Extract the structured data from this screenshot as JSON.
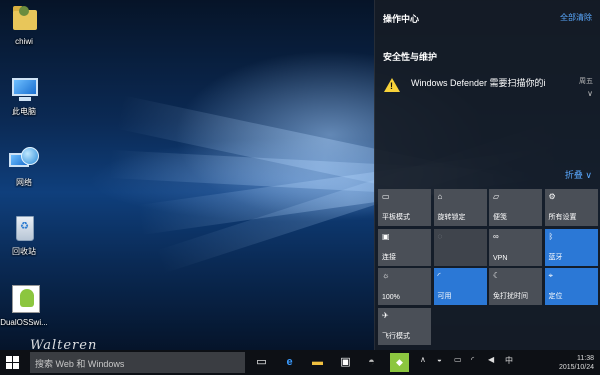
{
  "desktop": {
    "icons": [
      {
        "label": "chiwi"
      },
      {
        "label": "此电脑"
      },
      {
        "label": "网络"
      },
      {
        "label": "回收站"
      },
      {
        "label": "DualOSSwi..."
      }
    ],
    "watermark": "Walteren"
  },
  "action_center": {
    "title": "操作中心",
    "clear_all": "全部清除",
    "group_title": "安全性与维护",
    "notification": {
      "text": "Windows Defender 需要扫描你的i",
      "day": "周五",
      "expand_icon": "chevron-down-icon",
      "icon": "warning-icon"
    },
    "collapse_label": "折叠",
    "tiles": [
      {
        "label": "平板模式",
        "icon": "tablet-icon",
        "state": "off",
        "glyph": "▭"
      },
      {
        "label": "旋转锁定",
        "icon": "rotation-lock-icon",
        "state": "off",
        "glyph": "⌂"
      },
      {
        "label": "便笺",
        "icon": "note-icon",
        "state": "off",
        "glyph": "▱"
      },
      {
        "label": "所有设置",
        "icon": "gear-icon",
        "state": "off",
        "glyph": "⚙"
      },
      {
        "label": "连接",
        "icon": "connect-icon",
        "state": "off",
        "glyph": "▣"
      },
      {
        "label": "",
        "icon": "location-icon",
        "state": "disabled",
        "glyph": "◌"
      },
      {
        "label": "VPN",
        "icon": "vpn-icon",
        "state": "off",
        "glyph": "∞"
      },
      {
        "label": "蓝牙",
        "icon": "bluetooth-icon",
        "state": "on",
        "glyph": "ᛒ"
      },
      {
        "label": "100%",
        "icon": "brightness-icon",
        "state": "off",
        "glyph": "☼"
      },
      {
        "label": "可用",
        "icon": "wifi-icon",
        "state": "on",
        "glyph": "◜"
      },
      {
        "label": "免打扰时间",
        "icon": "moon-icon",
        "state": "off",
        "glyph": "☾"
      },
      {
        "label": "定位",
        "icon": "location-pin-icon",
        "state": "on",
        "glyph": "⌖"
      },
      {
        "label": "飞行模式",
        "icon": "airplane-icon",
        "state": "off",
        "glyph": "✈"
      }
    ]
  },
  "taskbar": {
    "search_placeholder": "搜索 Web 和 Windows",
    "clock_time": "11:38",
    "clock_date": "2015/10/24"
  },
  "colors": {
    "accent": "#2b78d6",
    "link": "#5aa9ff",
    "warning": "#f7d23a"
  }
}
